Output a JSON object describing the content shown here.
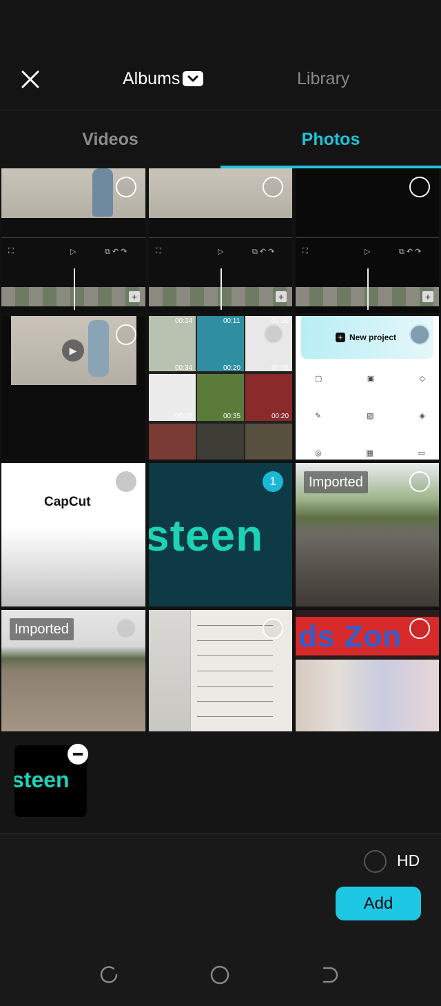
{
  "header": {
    "close_icon": "close-icon",
    "albums_label": "Albums",
    "albums_dropdown_icon": "chevron-down-icon",
    "library_label": "Library"
  },
  "tabs": [
    {
      "label": "Videos",
      "active": false
    },
    {
      "label": "Photos",
      "active": true
    }
  ],
  "colors": {
    "accent": "#20c4dc",
    "background": "#141414",
    "add_button": "#1ec7e3",
    "logo_text": "#1ed3b5"
  },
  "grid": {
    "items": [
      {
        "kind": "editor-screenshot",
        "selected": false
      },
      {
        "kind": "editor-screenshot",
        "selected": false
      },
      {
        "kind": "editor-screenshot",
        "selected": false
      },
      {
        "kind": "video-preview-screenshot",
        "selected": false
      },
      {
        "kind": "gallery-screenshot",
        "selected": false,
        "durations": [
          "00:24",
          "00:11",
          "00:26",
          "00:34",
          "00:20",
          "00:05",
          "00:05",
          "00:35",
          "00:20"
        ]
      },
      {
        "kind": "app-home-screenshot",
        "selected": false,
        "new_project_label": "New project"
      },
      {
        "kind": "capcut-logo",
        "selected": false,
        "logo_text": "CapCut"
      },
      {
        "kind": "steen-logo",
        "selected": true,
        "selection_number": "1",
        "logo_text": "steen"
      },
      {
        "kind": "photo",
        "selected": false,
        "badge": "Imported"
      },
      {
        "kind": "photo",
        "selected": false,
        "badge": "Imported"
      },
      {
        "kind": "handwritten-notes",
        "selected": false
      },
      {
        "kind": "shop-sign",
        "selected": false,
        "sign_text": "ds Zon"
      }
    ]
  },
  "selected_tray": {
    "items": [
      {
        "logo_text": "steen",
        "remove_icon": "remove-icon"
      }
    ]
  },
  "footer": {
    "hd_label": "HD",
    "hd_checked": false,
    "add_label": "Add"
  },
  "system_nav": [
    "recent-apps-icon",
    "home-icon",
    "back-icon"
  ]
}
